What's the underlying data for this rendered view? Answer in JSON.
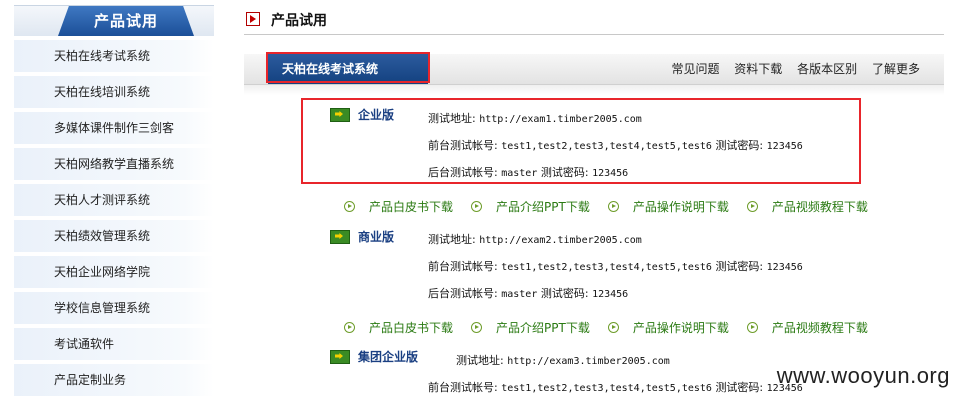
{
  "sidebar": {
    "title": "产品试用",
    "items": [
      {
        "label": "天柏在线考试系统"
      },
      {
        "label": "天柏在线培训系统"
      },
      {
        "label": "多媒体课件制作三剑客"
      },
      {
        "label": "天柏网络教学直播系统"
      },
      {
        "label": "天柏人才测评系统"
      },
      {
        "label": "天柏绩效管理系统"
      },
      {
        "label": "天柏企业网络学院"
      },
      {
        "label": "学校信息管理系统"
      },
      {
        "label": "考试通软件"
      },
      {
        "label": "产品定制业务"
      }
    ]
  },
  "main": {
    "page_title": "产品试用",
    "active_tab": "天柏在线考试系统",
    "tab_links": [
      "常见问题",
      "资料下载",
      "各版本区别",
      "了解更多"
    ],
    "editions": [
      {
        "name": "企业版",
        "test_url_label": "测试地址:",
        "test_url": "http://exam1.timber2005.com",
        "front_label": "前台测试帐号:",
        "front_accounts": "test1,test2,test3,test4,test5,test6",
        "front_pwd_label": "测试密码:",
        "front_pwd": "123456",
        "back_label": "后台测试帐号:",
        "back_account": "master",
        "back_pwd_label": "测试密码:",
        "back_pwd": "123456"
      },
      {
        "name": "商业版",
        "test_url_label": "测试地址:",
        "test_url": "http://exam2.timber2005.com",
        "front_label": "前台测试帐号:",
        "front_accounts": "test1,test2,test3,test4,test5,test6",
        "front_pwd_label": "测试密码:",
        "front_pwd": "123456",
        "back_label": "后台测试帐号:",
        "back_account": "master",
        "back_pwd_label": "测试密码:",
        "back_pwd": "123456"
      },
      {
        "name": "集团企业版",
        "test_url_label": "测试地址:",
        "test_url": "http://exam3.timber2005.com",
        "front_label": "前台测试帐号:",
        "front_accounts": "test1,test2,test3,test4,test5,test6",
        "front_pwd_label": "测试密码:",
        "front_pwd": "123456"
      }
    ],
    "downloads": [
      "产品白皮书下载",
      "产品介绍PPT下载",
      "产品操作说明下载",
      "产品视频教程下载"
    ]
  },
  "watermark": "www.wooyun.org",
  "colors": {
    "accent": "#1b4f98",
    "highlight_red": "#e8252b",
    "link_green": "#2a7a12"
  }
}
